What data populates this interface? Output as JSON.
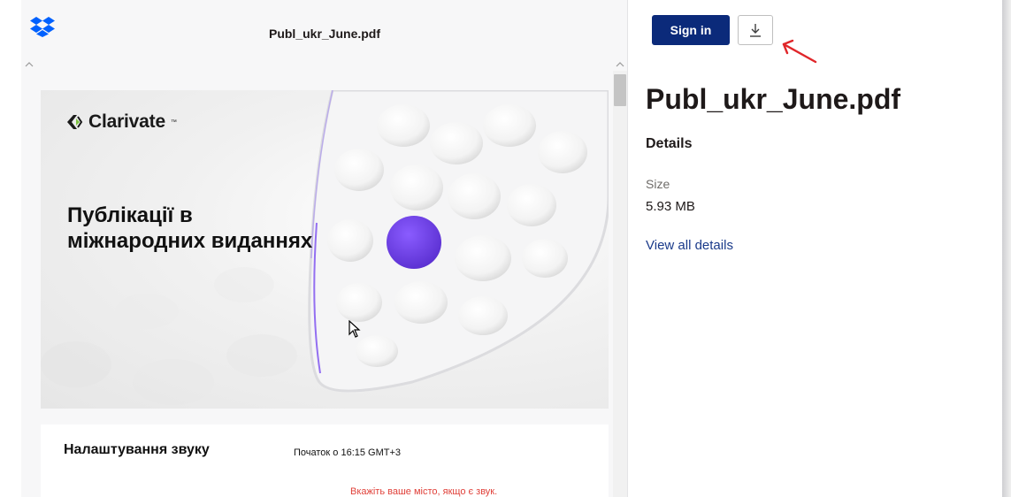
{
  "viewer": {
    "filename": "Publ_ukr_June.pdf",
    "logo_icon": "dropbox-icon",
    "cover": {
      "brand": "Clarivate",
      "brand_tm": "™",
      "title_line1": "Публікації в",
      "title_line2": "міжнародних виданнях"
    },
    "page_two": {
      "heading": "Налаштування звуку",
      "start_time": "Початок о 16:15 GMT+3",
      "city_hint": "Вкажіть ваше місто, якщо є звук."
    }
  },
  "side": {
    "signin_label": "Sign in",
    "download_icon": "download-icon",
    "title": "Publ_ukr_June.pdf",
    "details_heading": "Details",
    "size_label": "Size",
    "size_value": "5.93 MB",
    "view_all_label": "View all details"
  },
  "colors": {
    "signin_bg": "#0b2a7a",
    "link": "#1a3a8a",
    "accent_purple": "#6a3de8",
    "hint_red": "#e0413a",
    "annotation_red": "#e0262a"
  }
}
